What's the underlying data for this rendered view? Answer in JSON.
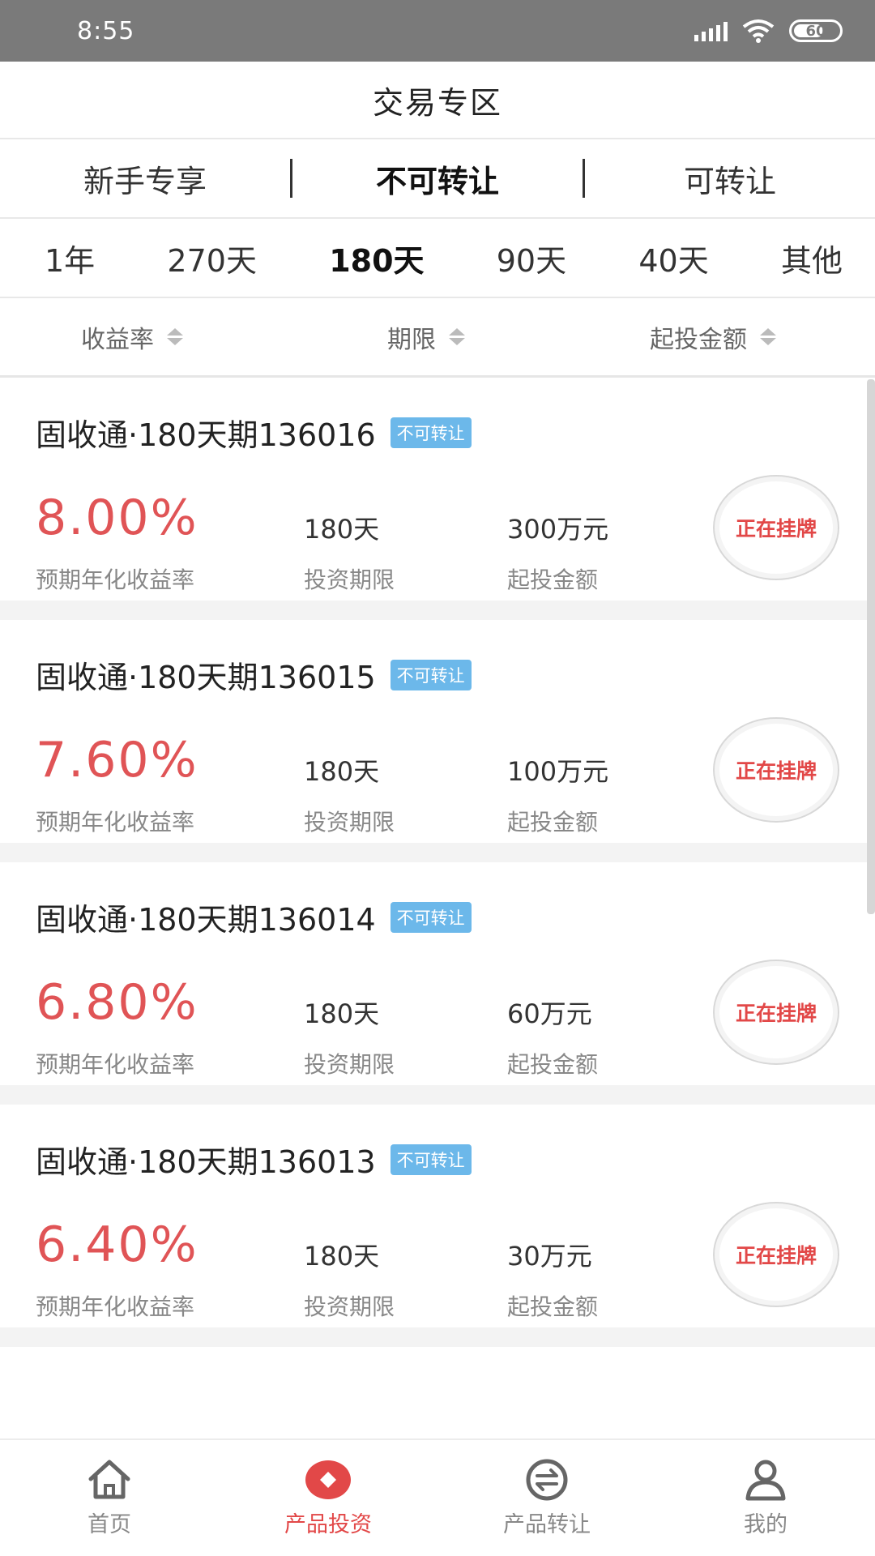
{
  "status_bar": {
    "time": "8:55",
    "battery": "60"
  },
  "header": {
    "title": "交易专区"
  },
  "segment_tabs": [
    {
      "label": "新手专享",
      "active": false
    },
    {
      "label": "不可转让",
      "active": true
    },
    {
      "label": "可转让",
      "active": false
    }
  ],
  "term_tabs": [
    {
      "label": "1年",
      "active": false
    },
    {
      "label": "270天",
      "active": false
    },
    {
      "label": "180天",
      "active": true
    },
    {
      "label": "90天",
      "active": false
    },
    {
      "label": "40天",
      "active": false
    },
    {
      "label": "其他",
      "active": false
    }
  ],
  "sort_bar": [
    {
      "label": "收益率"
    },
    {
      "label": "期限"
    },
    {
      "label": "起投金额"
    }
  ],
  "products": [
    {
      "name": "固收通·180天期136016",
      "tag": "不可转让",
      "rate": "8.00%",
      "rate_label": "预期年化收益率",
      "term": "180天",
      "term_label": "投资期限",
      "min_amount": "300万元",
      "min_label": "起投金额",
      "status": "正在挂牌"
    },
    {
      "name": "固收通·180天期136015",
      "tag": "不可转让",
      "rate": "7.60%",
      "rate_label": "预期年化收益率",
      "term": "180天",
      "term_label": "投资期限",
      "min_amount": "100万元",
      "min_label": "起投金额",
      "status": "正在挂牌"
    },
    {
      "name": "固收通·180天期136014",
      "tag": "不可转让",
      "rate": "6.80%",
      "rate_label": "预期年化收益率",
      "term": "180天",
      "term_label": "投资期限",
      "min_amount": "60万元",
      "min_label": "起投金额",
      "status": "正在挂牌"
    },
    {
      "name": "固收通·180天期136013",
      "tag": "不可转让",
      "rate": "6.40%",
      "rate_label": "预期年化收益率",
      "term": "180天",
      "term_label": "投资期限",
      "min_amount": "30万元",
      "min_label": "起投金额",
      "status": "正在挂牌"
    }
  ],
  "bottom_nav": [
    {
      "label": "首页",
      "icon": "home-icon",
      "active": false
    },
    {
      "label": "产品投资",
      "icon": "diamond-icon",
      "active": true
    },
    {
      "label": "产品转让",
      "icon": "exchange-icon",
      "active": false
    },
    {
      "label": "我的",
      "icon": "user-icon",
      "active": false
    }
  ],
  "colors": {
    "accent": "#e24848",
    "rate": "#e05456",
    "tag": "#6cb8ea",
    "status_bar": "#7a7a7a"
  }
}
